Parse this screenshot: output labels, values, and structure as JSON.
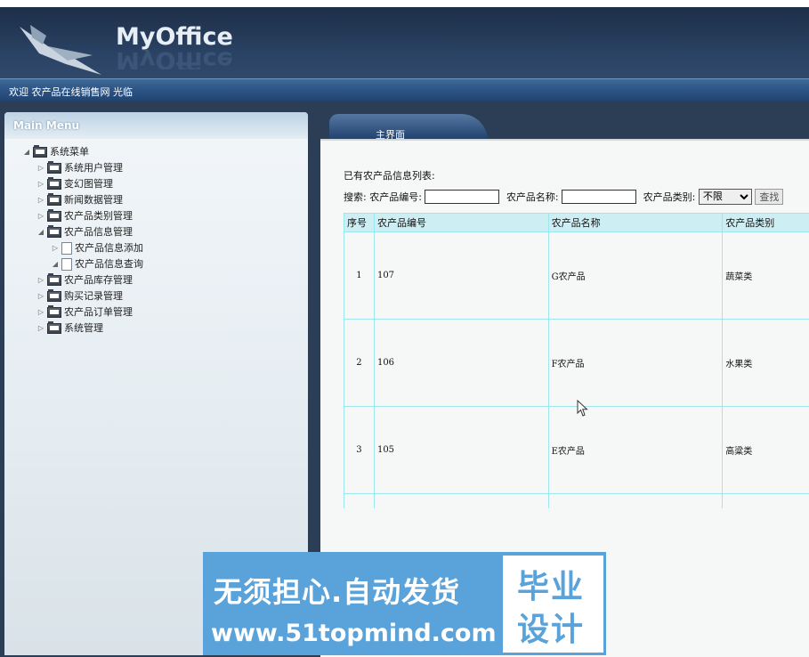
{
  "app": {
    "logo": "MyOffice"
  },
  "welcome": "欢迎 农产品在线销售网 光临",
  "sidebar": {
    "title": "Main Menu",
    "root": "系统菜单",
    "items": [
      "系统用户管理",
      "变幻图管理",
      "新闻数据管理",
      "农产品类别管理",
      "农产品信息管理",
      "农产品信息添加",
      "农产品信息查询",
      "农产品库存管理",
      "购买记录管理",
      "农产品订单管理",
      "系统管理"
    ]
  },
  "tab": {
    "label": "主界面"
  },
  "main": {
    "list_title": "已有农产品信息列表:",
    "search": {
      "prefix": "搜索:",
      "code_label": "农产品编号:",
      "name_label": "农产品名称:",
      "category_label": "农产品类别:",
      "category_value": "不限",
      "search_button": "查找"
    },
    "table": {
      "headers": [
        "序号",
        "农产品编号",
        "农产品名称",
        "农产品类别"
      ],
      "rows": [
        [
          "1",
          "107",
          "G农产品",
          "蔬菜类"
        ],
        [
          "2",
          "106",
          "F农产品",
          "水果类"
        ],
        [
          "3",
          "105",
          "E农产品",
          "高粱类"
        ]
      ]
    }
  },
  "banner": {
    "line1": "无须担心.自动发货",
    "line2": "www.51topmind.com",
    "right1": "毕业",
    "right2": "设计"
  },
  "colors": {
    "header": "#1d2e47",
    "accent": "#5aa3da",
    "table_border": "#9ee6ee"
  }
}
